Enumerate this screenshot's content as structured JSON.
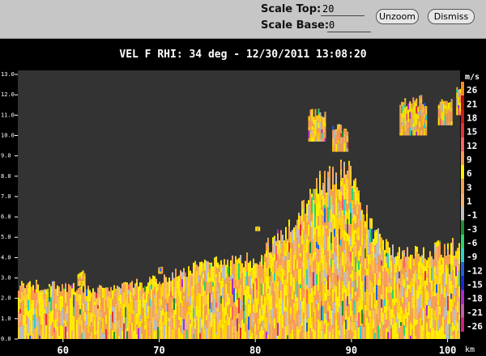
{
  "toolbar": {
    "scale_top_label": "Scale Top:",
    "scale_top_value": "20",
    "scale_base_label": "Scale Base:",
    "scale_base_value": "0",
    "unzoom_label": "Unzoom",
    "dismiss_label": "Dismiss"
  },
  "colors": {
    "toolbar_bg": "#c6c6c6",
    "plot_bg": "#333333",
    "page_bg": "#000000",
    "text": "#ffffff"
  },
  "chart_data": {
    "type": "heatmap",
    "title": "VEL F  RHI: 34 deg  -  12/30/2011 13:08:20",
    "x_unit": "km",
    "x_range": [
      55.3,
      101.3
    ],
    "x_ticks": [
      60,
      70,
      80,
      90,
      100
    ],
    "x_tick_labels": [
      "60",
      "70",
      "80",
      "90",
      "100"
    ],
    "y_range": [
      0,
      13.2
    ],
    "y_ticks": [
      0,
      1,
      2,
      3,
      4,
      5,
      6,
      7,
      8,
      9,
      10,
      11,
      12,
      13
    ],
    "y_tick_labels": [
      "0.0",
      "1.0",
      "2.0",
      "3.0",
      "4.0",
      "5.0",
      "6.0",
      "7.0",
      "8.0",
      "9.0",
      "10.0",
      "11.0",
      "12.0",
      "13.0"
    ],
    "colorbar": {
      "unit": "m/s",
      "entries": [
        {
          "label": "26",
          "color": "#ff8c1a"
        },
        {
          "label": "21",
          "color": "#b01010"
        },
        {
          "label": "18",
          "color": "#cc1a1a"
        },
        {
          "label": "15",
          "color": "#e83232"
        },
        {
          "label": "12",
          "color": "#ff6060"
        },
        {
          "label": "9",
          "color": "#ff9a55"
        },
        {
          "label": "6",
          "color": "#ffee00"
        },
        {
          "label": "3",
          "color": "#f2a24c"
        },
        {
          "label": "1",
          "color": "#f5b070"
        },
        {
          "label": "-1",
          "color": "#bdbdbd"
        },
        {
          "label": "-3",
          "color": "#1f8f2f"
        },
        {
          "label": "-6",
          "color": "#28d66a"
        },
        {
          "label": "-9",
          "color": "#2ed0c8"
        },
        {
          "label": "-12",
          "color": "#2060e0"
        },
        {
          "label": "-15",
          "color": "#1a2ad6"
        },
        {
          "label": "-18",
          "color": "#b02ad0"
        },
        {
          "label": "-21",
          "color": "#c85aa8"
        },
        {
          "label": "-26",
          "color": "#d0207a"
        }
      ]
    },
    "echo_top_profile": [
      {
        "x": 55.3,
        "top": 2.7
      },
      {
        "x": 59,
        "top": 2.7
      },
      {
        "x": 62,
        "top": 2.5
      },
      {
        "x": 65,
        "top": 2.5
      },
      {
        "x": 68,
        "top": 2.8
      },
      {
        "x": 71,
        "top": 3.1
      },
      {
        "x": 74,
        "top": 3.7
      },
      {
        "x": 77,
        "top": 3.8
      },
      {
        "x": 80,
        "top": 4.0
      },
      {
        "x": 81,
        "top": 4.6
      },
      {
        "x": 83,
        "top": 5.4
      },
      {
        "x": 85,
        "top": 6.4
      },
      {
        "x": 86,
        "top": 7.6
      },
      {
        "x": 88,
        "top": 8.3
      },
      {
        "x": 90,
        "top": 8.2
      },
      {
        "x": 92,
        "top": 5.6
      },
      {
        "x": 94,
        "top": 4.6
      },
      {
        "x": 96,
        "top": 4.2
      },
      {
        "x": 98,
        "top": 4.4
      },
      {
        "x": 100,
        "top": 4.6
      },
      {
        "x": 101.3,
        "top": 4.6
      }
    ],
    "isolated_echoes": [
      {
        "x0": 61.5,
        "x1": 62.2,
        "y0": 2.6,
        "y1": 3.4
      },
      {
        "x0": 69.9,
        "x1": 70.3,
        "y0": 3.2,
        "y1": 3.6
      },
      {
        "x0": 80.0,
        "x1": 80.4,
        "y0": 5.3,
        "y1": 5.6
      },
      {
        "x0": 85.5,
        "x1": 87.2,
        "y0": 9.7,
        "y1": 11.4
      },
      {
        "x0": 88.0,
        "x1": 89.6,
        "y0": 9.2,
        "y1": 10.6
      },
      {
        "x0": 95.0,
        "x1": 97.8,
        "y0": 10.0,
        "y1": 12.0
      },
      {
        "x0": 99.0,
        "x1": 100.4,
        "y0": 10.5,
        "y1": 11.8
      },
      {
        "x0": 100.9,
        "x1": 101.3,
        "y0": 11.0,
        "y1": 12.6
      }
    ]
  }
}
